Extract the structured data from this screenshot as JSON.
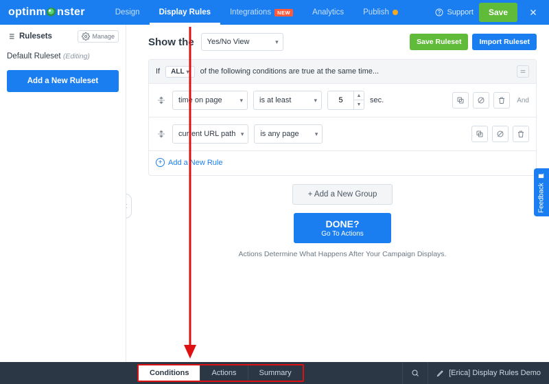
{
  "brand": {
    "part1": "optin",
    "part2": "m",
    "part3": "nster"
  },
  "nav": {
    "design": "Design",
    "display_rules": "Display Rules",
    "integrations": "Integrations",
    "integrations_badge": "NEW",
    "analytics": "Analytics",
    "publish": "Publish"
  },
  "top": {
    "support": "Support",
    "save": "Save"
  },
  "sidebar": {
    "rulesets_label": "Rulesets",
    "manage": "Manage",
    "default_name": "Default Ruleset",
    "editing": "(Editing)",
    "add_ruleset": "Add a New Ruleset"
  },
  "head": {
    "title": "Show the",
    "view_select": "Yes/No View",
    "save_ruleset": "Save Ruleset",
    "import_ruleset": "Import Ruleset"
  },
  "group": {
    "if": "If",
    "scope": "ALL",
    "tail": "of the following conditions are true at the same time..."
  },
  "rule1": {
    "metric": "time on page",
    "op": "is at least",
    "value": "5",
    "unit": "sec."
  },
  "rule2": {
    "metric": "current URL path",
    "op": "is any page"
  },
  "and": "And",
  "actions": {
    "add_rule": "Add a New Rule",
    "add_group": "+ Add a New Group"
  },
  "done": {
    "big": "DONE?",
    "small": "Go To Actions",
    "desc": "Actions Determine What Happens After Your Campaign Displays."
  },
  "bottom": {
    "tabs": {
      "conditions": "Conditions",
      "actions": "Actions",
      "summary": "Summary"
    },
    "campaign": "[Erica] Display Rules Demo"
  },
  "feedback": "Feedback"
}
